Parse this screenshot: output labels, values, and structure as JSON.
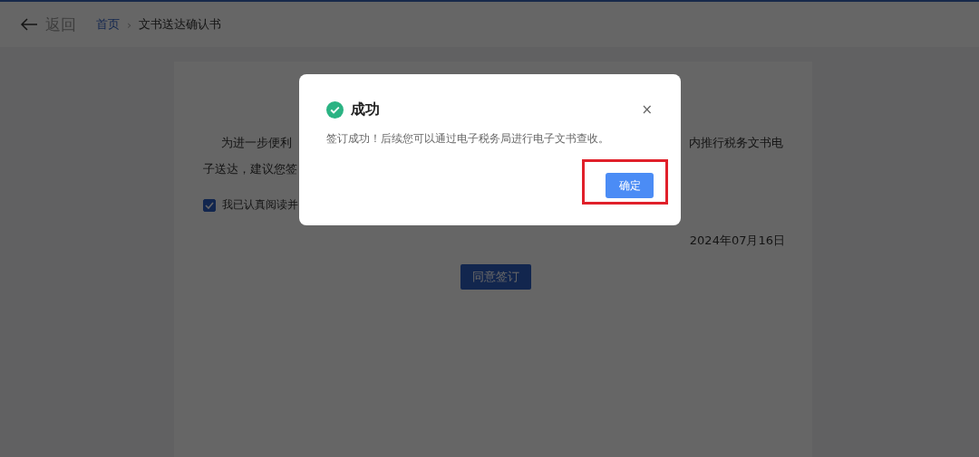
{
  "header": {
    "back": "返回",
    "separator": "›",
    "breadcrumb": [
      {
        "label": "首页",
        "link": true
      },
      {
        "label": "文书送达确认书",
        "link": false
      }
    ]
  },
  "document": {
    "paragraph_line1_left": "为进一步便利",
    "paragraph_line1_right": "内推行税务文书电",
    "paragraph_line2_left": "子送达，建议您签",
    "agreement": {
      "label": "我已认真阅读并",
      "checked": true
    },
    "date": "2024年07月16日",
    "sign_button": "同意签订"
  },
  "dialog": {
    "title": "成功",
    "message": "签订成功！后续您可以通过电子税务局进行电子文书查收。",
    "close": "×",
    "confirm": "确定",
    "confirm_highlighted": true
  }
}
